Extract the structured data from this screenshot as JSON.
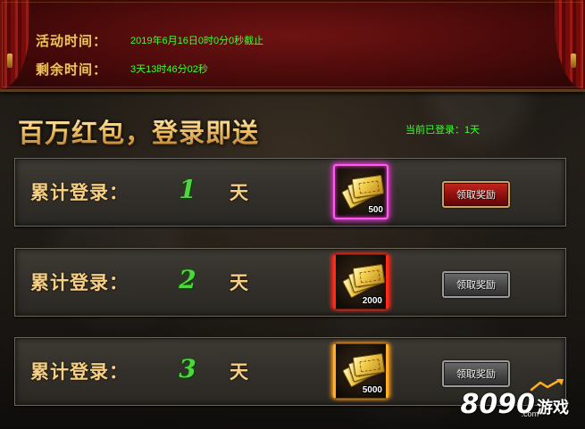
{
  "event": {
    "activity_time_label": "活动时间：",
    "activity_time_value": "2019年6月16日0时0分0秒截止",
    "remaining_time_label": "剩余时间：",
    "remaining_time_value": "3天13时46分02秒"
  },
  "title": "百万红包，登录即送",
  "logged_in_status": "当前已登录：1天",
  "rewards": [
    {
      "label": "累计登录：",
      "days": "1",
      "unit": "天",
      "amount": "500",
      "frame": "pink",
      "button": "领取奖励",
      "button_state": "active"
    },
    {
      "label": "累计登录：",
      "days": "2",
      "unit": "天",
      "amount": "2000",
      "frame": "red",
      "button": "领取奖励",
      "button_state": "disabled"
    },
    {
      "label": "累计登录：",
      "days": "3",
      "unit": "天",
      "amount": "5000",
      "frame": "orange",
      "button": "领取奖励",
      "button_state": "disabled"
    }
  ],
  "watermark": {
    "number": "8090",
    "text": "游戏",
    "domain": ".com"
  },
  "colors": {
    "banner_red": "#6e1312",
    "gold_text": "#f4cf86",
    "green_text": "#3cff2e",
    "day_green": "#4ed63e",
    "active_button": "#c5261f",
    "disabled_button": "#474747"
  },
  "icons": {
    "reward": "ticket-stack-icon",
    "watermark": "logo-arrow-icon"
  }
}
